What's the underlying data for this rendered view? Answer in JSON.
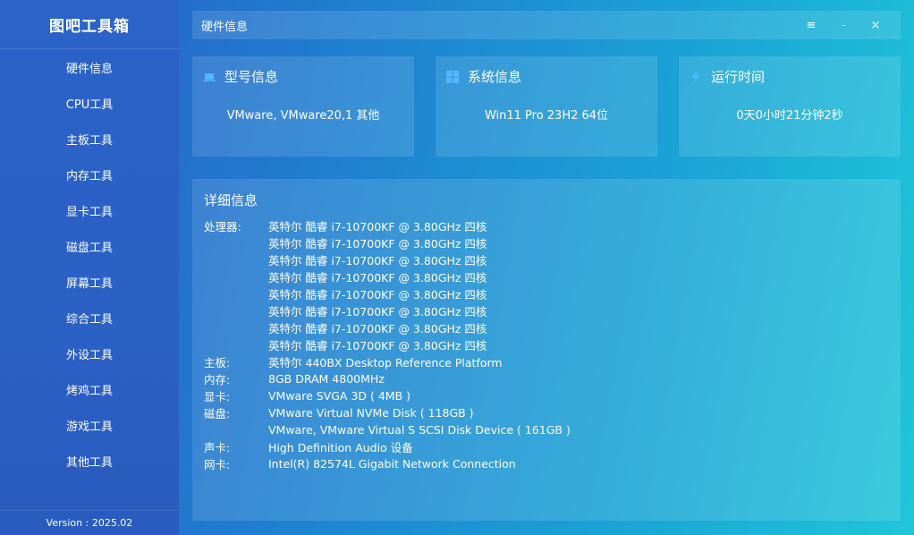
{
  "app": {
    "title": "图吧工具箱",
    "version": "Version : 2025.02"
  },
  "sidebar": {
    "items": [
      {
        "label": "硬件信息"
      },
      {
        "label": "CPU工具"
      },
      {
        "label": "主板工具"
      },
      {
        "label": "内存工具"
      },
      {
        "label": "显卡工具"
      },
      {
        "label": "磁盘工具"
      },
      {
        "label": "屏幕工具"
      },
      {
        "label": "综合工具"
      },
      {
        "label": "外设工具"
      },
      {
        "label": "烤鸡工具"
      },
      {
        "label": "游戏工具"
      },
      {
        "label": "其他工具"
      }
    ]
  },
  "header": {
    "title": "硬件信息",
    "menu_icon": "≡",
    "minimize_icon": "-",
    "close_icon": "×"
  },
  "cards": [
    {
      "title": "型号信息",
      "value": "VMware, VMware20,1 其他",
      "icon": "laptop-icon"
    },
    {
      "title": "系统信息",
      "value": "Win11 Pro 23H2 64位",
      "icon": "windows-icon"
    },
    {
      "title": "运行时间",
      "value": "0天0小时21分钟2秒",
      "icon": "lightning-icon"
    }
  ],
  "detail": {
    "title": "详细信息",
    "rows": [
      {
        "label": "处理器:",
        "value": "英特尔 酷睿 i7-10700KF @ 3.80GHz 四核"
      },
      {
        "label": "",
        "value": "英特尔 酷睿 i7-10700KF @ 3.80GHz 四核"
      },
      {
        "label": "",
        "value": "英特尔 酷睿 i7-10700KF @ 3.80GHz 四核"
      },
      {
        "label": "",
        "value": "英特尔 酷睿 i7-10700KF @ 3.80GHz 四核"
      },
      {
        "label": "",
        "value": "英特尔 酷睿 i7-10700KF @ 3.80GHz 四核"
      },
      {
        "label": "",
        "value": "英特尔 酷睿 i7-10700KF @ 3.80GHz 四核"
      },
      {
        "label": "",
        "value": "英特尔 酷睿 i7-10700KF @ 3.80GHz 四核"
      },
      {
        "label": "",
        "value": "英特尔 酷睿 i7-10700KF @ 3.80GHz 四核"
      },
      {
        "label": "主板:",
        "value": "英特尔 440BX Desktop Reference Platform"
      },
      {
        "label": "内存:",
        "value": "8GB DRAM 4800MHz"
      },
      {
        "label": "显卡:",
        "value": "VMware SVGA 3D ( 4MB )"
      },
      {
        "label": "磁盘:",
        "value": "VMware Virtual NVMe Disk ( 118GB )"
      },
      {
        "label": "",
        "value": "VMware, VMware Virtual S SCSI Disk Device ( 161GB )"
      },
      {
        "label": "声卡:",
        "value": "High Definition Audio 设备"
      },
      {
        "label": "网卡:",
        "value": "Intel(R) 82574L Gigabit Network Connection"
      }
    ]
  }
}
